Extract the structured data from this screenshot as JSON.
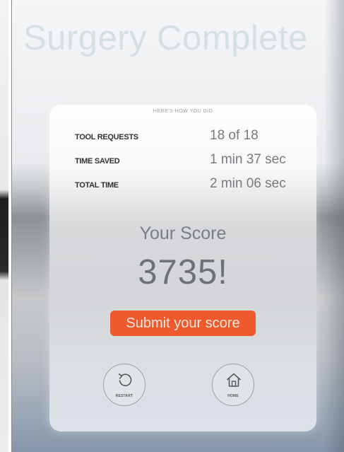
{
  "title": "Surgery Complete",
  "card": {
    "header": "HERE'S HOW YOU DID",
    "stats": [
      {
        "label": "TOOL REQUESTS",
        "value": "18 of 18"
      },
      {
        "label": "TIME SAVED",
        "value": "1 min 37 sec"
      },
      {
        "label": "TOTAL TIME",
        "value": "2 min 06 sec"
      }
    ],
    "score_label": "Your Score",
    "score_value": "3735!",
    "submit_label": "Submit your score",
    "restart": {
      "label": "RESTART",
      "icon": "restart-icon"
    },
    "home": {
      "label": "HOME",
      "icon": "home-icon"
    }
  },
  "colors": {
    "accent": "#ef5a2c",
    "title": "#d5e0e3",
    "text": "#333333",
    "value": "#777b7f"
  }
}
